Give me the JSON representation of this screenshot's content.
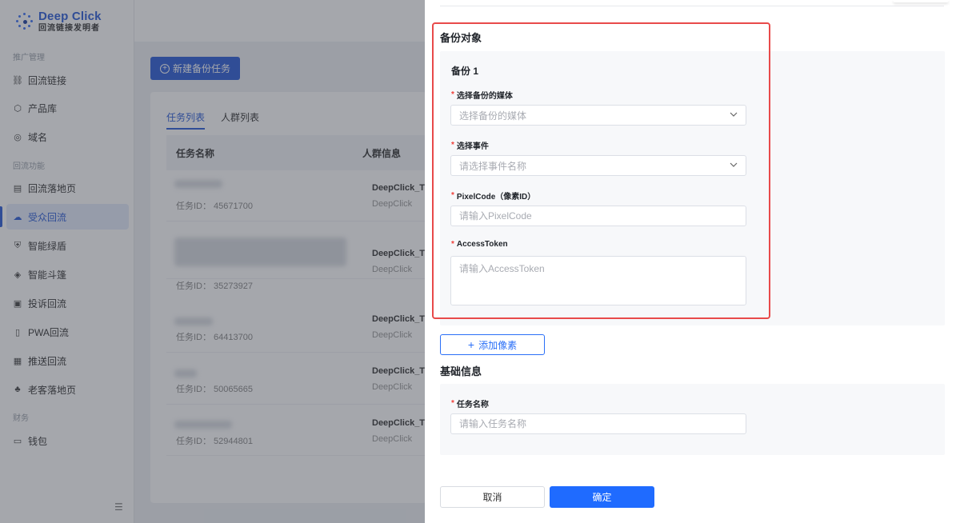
{
  "logo": {
    "title": "Deep Click",
    "subtitle": "回流链接发明者"
  },
  "sidebar": {
    "groups": [
      "推广管理",
      "回流功能",
      "财务"
    ],
    "items": [
      {
        "label": "回流链接",
        "icon": "link-icon"
      },
      {
        "label": "产品库",
        "icon": "box-icon"
      },
      {
        "label": "域名",
        "icon": "globe-icon"
      },
      {
        "label": "回流落地页",
        "icon": "page-icon"
      },
      {
        "label": "受众回流",
        "icon": "cloud-icon",
        "active": true
      },
      {
        "label": "智能绿盾",
        "icon": "shield-icon"
      },
      {
        "label": "智能斗篷",
        "icon": "cloak-icon"
      },
      {
        "label": "投诉回流",
        "icon": "complaint-icon"
      },
      {
        "label": "PWA回流",
        "icon": "phone-icon"
      },
      {
        "label": "推送回流",
        "icon": "push-icon"
      },
      {
        "label": "老客落地页",
        "icon": "layers-icon"
      },
      {
        "label": "钱包",
        "icon": "wallet-icon"
      }
    ]
  },
  "main": {
    "new_task_label": "新建备份任务",
    "tabs": [
      "任务列表",
      "人群列表"
    ],
    "columns": [
      "任务名称",
      "人群信息"
    ],
    "rows": [
      {
        "task_id": "任务ID：  45671700",
        "group": "DeepClick_T",
        "group_sub": "DeepClick"
      },
      {
        "task_id": "任务ID：  35273927",
        "group": "DeepClick_T",
        "group_sub": "DeepClick"
      },
      {
        "task_id": "任务ID：  64413700",
        "group": "DeepClick_T",
        "group_sub": "DeepClick"
      },
      {
        "task_id": "任务ID：  50065665",
        "group": "DeepClick_T",
        "group_sub": "DeepClick"
      },
      {
        "task_id": "任务ID：  52944801",
        "group": "DeepClick_T",
        "group_sub": "DeepClick"
      }
    ]
  },
  "drawer": {
    "backup_section_title": "备份对象",
    "backup_item_title": "备份 1",
    "media_label": "选择备份的媒体",
    "media_placeholder": "选择备份的媒体",
    "event_label": "选择事件",
    "event_placeholder": "请选择事件名称",
    "pixel_label": "PixelCode（像素ID）",
    "pixel_placeholder": "请输入PixelCode",
    "token_label": "AccessToken",
    "token_placeholder": "请输入AccessToken",
    "add_pixel_label": "添加像素",
    "basic_section_title": "基础信息",
    "task_name_label": "任务名称",
    "task_name_placeholder": "请输入任务名称",
    "cancel_label": "取消",
    "ok_label": "确定",
    "required_mark": "*"
  },
  "colors": {
    "primary": "#1f6bff",
    "highlight": "#e84a4a",
    "required": "#f0413b"
  }
}
